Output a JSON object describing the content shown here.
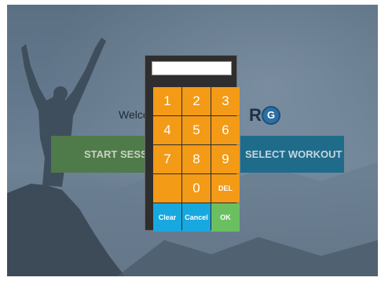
{
  "welcome": {
    "text": "Welcome"
  },
  "logo": {
    "letter_r": "R",
    "letter_g": "G"
  },
  "buttons": {
    "start_session": "START SESSION",
    "select_workout": "SELECT WORKOUT"
  },
  "keypad": {
    "display_value": "",
    "keys": [
      "1",
      "2",
      "3",
      "4",
      "5",
      "6",
      "7",
      "8",
      "9",
      "",
      "0",
      "DEL"
    ],
    "actions": {
      "clear": "Clear",
      "cancel": "Cancel",
      "ok": "OK"
    }
  },
  "colors": {
    "key_orange": "#f39a16",
    "key_blue": "#17a8e0",
    "key_green": "#6bbf61",
    "start_green": "#4f7a49",
    "select_blue": "#1e6c8a"
  }
}
